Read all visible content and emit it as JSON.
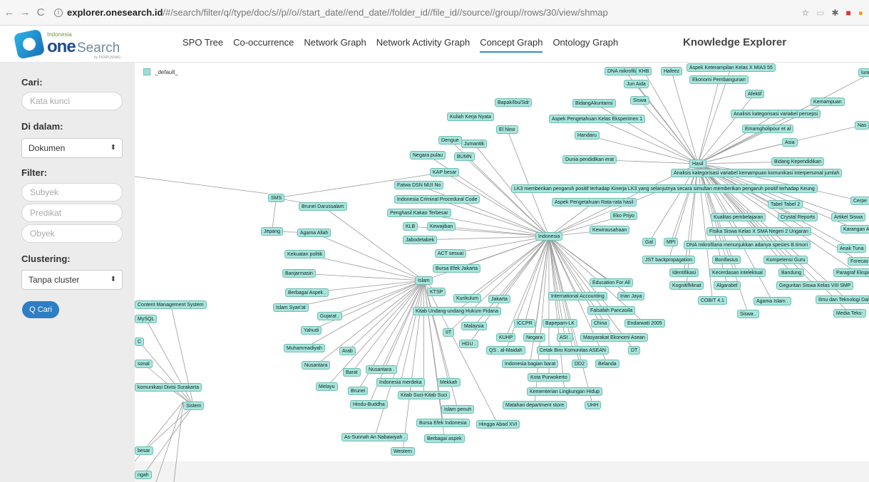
{
  "browser": {
    "back": "←",
    "forward": "→",
    "reload": "C",
    "url_host": "explorer.onesearch.id",
    "url_path": "/#/search/filter/q//type/doc/s//p//o//start_date//end_date//folder_id//file_id//source//group//rows/30/view/shmap"
  },
  "logo": {
    "small": "Indonesia",
    "one": "one",
    "search": "Search",
    "perpus": "by PERPUSNAS"
  },
  "menu": [
    "SPO Tree",
    "Co-occurrence",
    "Network Graph",
    "Network Activity Graph",
    "Concept Graph",
    "Ontology Graph"
  ],
  "menu_active": "Concept Graph",
  "header_title": "Knowledge Explorer",
  "sidebar": {
    "cari_label": "Cari:",
    "cari_placeholder": "Kata kunci",
    "didalam_label": "Di dalam:",
    "didalam_value": "Dokumen",
    "filter_label": "Filter:",
    "subyek": "Subyek",
    "predikat": "Predikat",
    "obyek": "Obyek",
    "clustering_label": "Clustering:",
    "clustering_value": "Tanpa cluster",
    "search_button": "Q Cari"
  },
  "legend": "_default_",
  "colors": {
    "node_fill": "#a8e6dc",
    "node_border": "#6fbcb2",
    "accent": "#2d7ec4"
  },
  "graph": {
    "nodes": [
      {
        "id": "indonesia",
        "label": "Indonesia"
      },
      {
        "id": "islam",
        "label": "Islam"
      },
      {
        "id": "hasil",
        "label": "Hasil"
      },
      {
        "id": "sms",
        "label": "SMS"
      },
      {
        "id": "jepang",
        "label": "Jepang"
      },
      {
        "id": "sistem",
        "label": "Sistem"
      },
      {
        "id": "dna1",
        "label": "DNA mikrofilaria"
      },
      {
        "id": "khb",
        "label": "KHB"
      },
      {
        "id": "hafeez",
        "label": "Hafeez"
      },
      {
        "id": "aspekket",
        "label": "Aspek Keterampilan Kelas X MIA3 55"
      },
      {
        "id": "junaida",
        "label": "Jun Aida"
      },
      {
        "id": "ekonomi",
        "label": "Ekonomi Pembangunan"
      },
      {
        "id": "siswa",
        "label": "Siswa"
      },
      {
        "id": "bidangak",
        "label": "BidangAkuntansi"
      },
      {
        "id": "afektif",
        "label": "Afektif"
      },
      {
        "id": "kemampuan",
        "label": "Kemampuan"
      },
      {
        "id": "bapak",
        "label": "Bapak/Ibu/Sdr"
      },
      {
        "id": "aspekpeng",
        "label": "Aspek Pengetahuan Kelas Eksperimen 1"
      },
      {
        "id": "analisis1",
        "label": "Analisis kategorisasi variabel persepsi"
      },
      {
        "id": "kuliah",
        "label": "Kuliah Kerja Nyata"
      },
      {
        "id": "elnino",
        "label": "El Nino"
      },
      {
        "id": "handaru",
        "label": "Handaru"
      },
      {
        "id": "emamgh",
        "label": "Emamgholipour et al"
      },
      {
        "id": "dengue",
        "label": "Dengue"
      },
      {
        "id": "jumantik",
        "label": "Jumantik"
      },
      {
        "id": "asia",
        "label": "Asia"
      },
      {
        "id": "negarapulau",
        "label": "Negara pulau"
      },
      {
        "id": "bumn",
        "label": "BUMN"
      },
      {
        "id": "duniapend",
        "label": "Dunia pendidikan erat"
      },
      {
        "id": "bidangkep",
        "label": "Bidang Kependidikan"
      },
      {
        "id": "kapbesar",
        "label": "KAP besar"
      },
      {
        "id": "analisis2",
        "label": "Analisis kategorisasi variabel kemampuan komunikasi interpersonal jumlah"
      },
      {
        "id": "fatwa",
        "label": "Fatwa DSN MUI No"
      },
      {
        "id": "icpc",
        "label": "Indonesia Criminal Procedural Code"
      },
      {
        "id": "lk3",
        "label": "LK3 memberikan pengaruh positif terhadap Kinerja LK3 yang selanjutnya secara simultan memberikan pengaruh positif terhadap Keung"
      },
      {
        "id": "aspekrata",
        "label": "Aspek Pengetahuan Rata-rata hasil"
      },
      {
        "id": "tabel2",
        "label": "Tabel Tabel 2"
      },
      {
        "id": "cerpe",
        "label": "Cerpe"
      },
      {
        "id": "brunei1",
        "label": "Brunei Darussalam"
      },
      {
        "id": "penghasil",
        "label": "Penghasil Kakao Terbesar"
      },
      {
        "id": "ekopriyo",
        "label": "Eko Priyo"
      },
      {
        "id": "kualitas",
        "label": "Kualitas pembelajaran"
      },
      {
        "id": "crystal",
        "label": "Crystal Reports"
      },
      {
        "id": "artikel",
        "label": "Artikel Siswa"
      },
      {
        "id": "klb",
        "label": "KLB"
      },
      {
        "id": "kewajiban",
        "label": "Kewajiban"
      },
      {
        "id": "kewirausahaan",
        "label": "Kewirausahaan"
      },
      {
        "id": "fisika",
        "label": "Fisika Siswa Kelas X SMA Negeri 2 Ungaran"
      },
      {
        "id": "karangan",
        "label": "Karangan A"
      },
      {
        "id": "agamaallah",
        "label": "Agama Allah"
      },
      {
        "id": "jabodetabek",
        "label": "Jabodetabek"
      },
      {
        "id": "gal",
        "label": "Gal"
      },
      {
        "id": "mpi",
        "label": "MPI"
      },
      {
        "id": "dna2",
        "label": "DNA mikrofilaria menunjukkan adanya spesies B.timori"
      },
      {
        "id": "anaktuna",
        "label": "Anak Tuna"
      },
      {
        "id": "kekuatan",
        "label": "Kekuatan politik"
      },
      {
        "id": "actsesuai",
        "label": "ACT sesuai"
      },
      {
        "id": "jst",
        "label": "JST backpropagation"
      },
      {
        "id": "bonifasius",
        "label": "Bonifasius"
      },
      {
        "id": "kompetensi",
        "label": "Kompetensi Guru"
      },
      {
        "id": "forecast",
        "label": "Forecas"
      },
      {
        "id": "bursa1",
        "label": "Bursa Efek Jakarta"
      },
      {
        "id": "banjarmasin",
        "label": "Banjarmasin"
      },
      {
        "id": "identifikasi",
        "label": "Identifikasi"
      },
      {
        "id": "kecerdasan",
        "label": "Kecerdasan intelektual"
      },
      {
        "id": "bandung",
        "label": "Bandung"
      },
      {
        "id": "paragraf",
        "label": "Paragraf Eksposisi"
      },
      {
        "id": "eduall",
        "label": "Education For All"
      },
      {
        "id": "kognitif",
        "label": "KognitifMinat"
      },
      {
        "id": "algarabel",
        "label": "Algarabel"
      },
      {
        "id": "geguritan",
        "label": "Geguritan Siswa Kelas VIII SMP"
      },
      {
        "id": "berbagai1",
        "label": "Berbagai Aspek ."
      },
      {
        "id": "ktsp",
        "label": "KTSP"
      },
      {
        "id": "intacc",
        "label": "International Accounting"
      },
      {
        "id": "irianjaya",
        "label": "Irian Jaya"
      },
      {
        "id": "cobit",
        "label": "COBIT 4.1"
      },
      {
        "id": "agamaislam",
        "label": "Agama Islam ."
      },
      {
        "id": "ilmu",
        "label": "Ilmu dan Teknologi Dalam"
      },
      {
        "id": "cms",
        "label": "Content Management System"
      },
      {
        "id": "islamsyariat",
        "label": "Islam Syari'at"
      },
      {
        "id": "kurikulum",
        "label": "Kurikulum"
      },
      {
        "id": "jakarta",
        "label": "Jakarta"
      },
      {
        "id": "falsafah",
        "label": "Falsafah Pancasila"
      },
      {
        "id": "mediateks",
        "label": "Media Teks-"
      },
      {
        "id": "mysql",
        "label": "MySQL"
      },
      {
        "id": "kitabuu",
        "label": "Kitab Undang-undang Hukum Pidana"
      },
      {
        "id": "siswadot",
        "label": "Siswa ."
      },
      {
        "id": "gujarat",
        "label": "Gujarat ."
      },
      {
        "id": "iccpr",
        "label": "ICCPR"
      },
      {
        "id": "bapepam",
        "label": "Bapepam-LK"
      },
      {
        "id": "china",
        "label": "China"
      },
      {
        "id": "endarwati",
        "label": "Endarwati 2005"
      },
      {
        "id": "malaysia",
        "label": "Malaysia"
      },
      {
        "id": "yahudi",
        "label": "Yahudi"
      },
      {
        "id": "iit",
        "label": "IIT"
      },
      {
        "id": "kuhp",
        "label": "KUHP"
      },
      {
        "id": "negara",
        "label": "Negara"
      },
      {
        "id": "asi",
        "label": "ASI ."
      },
      {
        "id": "masyarakat",
        "label": "Masyarakat Ekonomi Asean"
      },
      {
        "id": "muhammadiyah",
        "label": "Muhammadiyah"
      },
      {
        "id": "hgu",
        "label": "HGU ."
      },
      {
        "id": "arab",
        "label": "Arab"
      },
      {
        "id": "qs",
        "label": "QS . al-Maidah"
      },
      {
        "id": "cetakbiru",
        "label": "Cetak Biru Komunitas ASEAN"
      },
      {
        "id": "dt",
        "label": "DT"
      },
      {
        "id": "nusantara1",
        "label": "Nusantara"
      },
      {
        "id": "sonal",
        "label": "sonal"
      },
      {
        "id": "indobarat",
        "label": "Indonesia bagian barat"
      },
      {
        "id": "dd2",
        "label": "DD2"
      },
      {
        "id": "belanda",
        "label": "Belanda"
      },
      {
        "id": "barat",
        "label": "Barat"
      },
      {
        "id": "nusantara2",
        "label": "Nusantara ."
      },
      {
        "id": "melayu",
        "label": "Melayu"
      },
      {
        "id": "indomerdeka",
        "label": "Indonesia merdeka"
      },
      {
        "id": "mekkah",
        "label": "Mekkah"
      },
      {
        "id": "kotapur",
        "label": "Kota Purwokerto"
      },
      {
        "id": "komunikasi",
        "label": "komunikasi Divisi Surakarta"
      },
      {
        "id": "brunei2",
        "label": "Brunei"
      },
      {
        "id": "kitabsuci",
        "label": "Kitab Suci-Kitab Suci"
      },
      {
        "id": "kementerian",
        "label": "Kementerian Lingkungan Hidup"
      },
      {
        "id": "hindu",
        "label": "Hindu-Buddha"
      },
      {
        "id": "islampenuh",
        "label": "Islam penuh"
      },
      {
        "id": "matahari",
        "label": "Matahari department store"
      },
      {
        "id": "uhh",
        "label": "UHH"
      },
      {
        "id": "bursa2",
        "label": "Bursa Efek Indonesia"
      },
      {
        "id": "hingga",
        "label": "Hingga Abad XVI"
      },
      {
        "id": "assunnah",
        "label": "As-Sunnah An Nabawiyah ."
      },
      {
        "id": "berbagai2",
        "label": "Berbagai aspek"
      },
      {
        "id": "western",
        "label": "Western"
      },
      {
        "id": "besar",
        "label": "besar"
      },
      {
        "id": "ngah",
        "label": "ngah"
      },
      {
        "id": "luran",
        "label": "luran Jam"
      },
      {
        "id": "nas",
        "label": "Nas"
      },
      {
        "id": "cnode",
        "label": "C"
      }
    ],
    "edges": [
      [
        "indonesia",
        "kapbesar"
      ],
      [
        "indonesia",
        "fatwa"
      ],
      [
        "indonesia",
        "icpc"
      ],
      [
        "indonesia",
        "penghasil"
      ],
      [
        "indonesia",
        "klb"
      ],
      [
        "indonesia",
        "kewajiban"
      ],
      [
        "indonesia",
        "jabodetabek"
      ],
      [
        "indonesia",
        "actsesuai"
      ],
      [
        "indonesia",
        "bursa1"
      ],
      [
        "indonesia",
        "islam"
      ],
      [
        "indonesia",
        "kurikulum"
      ],
      [
        "indonesia",
        "jakarta"
      ],
      [
        "indonesia",
        "kitabuu"
      ],
      [
        "indonesia",
        "iccpr"
      ],
      [
        "indonesia",
        "bapepam"
      ],
      [
        "indonesia",
        "china"
      ],
      [
        "indonesia",
        "endarwati"
      ],
      [
        "indonesia",
        "malaysia"
      ],
      [
        "indonesia",
        "kuhp"
      ],
      [
        "indonesia",
        "negara"
      ],
      [
        "indonesia",
        "asi"
      ],
      [
        "indonesia",
        "masyarakat"
      ],
      [
        "indonesia",
        "qs"
      ],
      [
        "indonesia",
        "cetakbiru"
      ],
      [
        "indonesia",
        "dt"
      ],
      [
        "indonesia",
        "indobarat"
      ],
      [
        "indonesia",
        "dd2"
      ],
      [
        "indonesia",
        "belanda"
      ],
      [
        "indonesia",
        "intacc"
      ],
      [
        "indonesia",
        "irianjaya"
      ],
      [
        "indonesia",
        "falsafah"
      ],
      [
        "indonesia",
        "eduall"
      ],
      [
        "indonesia",
        "hasil"
      ],
      [
        "indonesia",
        "lk3"
      ],
      [
        "indonesia",
        "aspekrata"
      ],
      [
        "indonesia",
        "ekopriyo"
      ],
      [
        "indonesia",
        "kewirausahaan"
      ],
      [
        "indonesia",
        "jumantik"
      ],
      [
        "indonesia",
        "elnino"
      ],
      [
        "indonesia",
        "bumn"
      ],
      [
        "indonesia",
        "negarapulau"
      ],
      [
        "indonesia",
        "dengue"
      ],
      [
        "indonesia",
        "hgu"
      ],
      [
        "indonesia",
        "iit"
      ],
      [
        "indonesia",
        "kotapur"
      ],
      [
        "indonesia",
        "kementerian"
      ],
      [
        "indonesia",
        "matahari"
      ],
      [
        "indonesia",
        "uhh"
      ],
      [
        "islam",
        "agamaallah"
      ],
      [
        "islam",
        "kekuatan"
      ],
      [
        "islam",
        "banjarmasin"
      ],
      [
        "islam",
        "berbagai1"
      ],
      [
        "islam",
        "ktsp"
      ],
      [
        "islam",
        "islamsyariat"
      ],
      [
        "islam",
        "gujarat"
      ],
      [
        "islam",
        "yahudi"
      ],
      [
        "islam",
        "muhammadiyah"
      ],
      [
        "islam",
        "arab"
      ],
      [
        "islam",
        "nusantara1"
      ],
      [
        "islam",
        "barat"
      ],
      [
        "islam",
        "nusantara2"
      ],
      [
        "islam",
        "melayu"
      ],
      [
        "islam",
        "brunei2"
      ],
      [
        "islam",
        "indomerdeka"
      ],
      [
        "islam",
        "mekkah"
      ],
      [
        "islam",
        "kitabsuci"
      ],
      [
        "islam",
        "hindu"
      ],
      [
        "islam",
        "islampenuh"
      ],
      [
        "islam",
        "bursa2"
      ],
      [
        "islam",
        "hingga"
      ],
      [
        "islam",
        "assunnah"
      ],
      [
        "islam",
        "berbagai2"
      ],
      [
        "islam",
        "western"
      ],
      [
        "islam",
        "brunei1"
      ],
      [
        "hasil",
        "dna1"
      ],
      [
        "hasil",
        "khb"
      ],
      [
        "hasil",
        "hafeez"
      ],
      [
        "hasil",
        "aspekket"
      ],
      [
        "hasil",
        "junaida"
      ],
      [
        "hasil",
        "ekonomi"
      ],
      [
        "hasil",
        "siswa"
      ],
      [
        "hasil",
        "bidangak"
      ],
      [
        "hasil",
        "afektif"
      ],
      [
        "hasil",
        "kemampuan"
      ],
      [
        "hasil",
        "aspekpeng"
      ],
      [
        "hasil",
        "analisis1"
      ],
      [
        "hasil",
        "handaru"
      ],
      [
        "hasil",
        "emamgh"
      ],
      [
        "hasil",
        "asia"
      ],
      [
        "hasil",
        "duniapend"
      ],
      [
        "hasil",
        "bidangkep"
      ],
      [
        "hasil",
        "analisis2"
      ],
      [
        "hasil",
        "tabel2"
      ],
      [
        "hasil",
        "kualitas"
      ],
      [
        "hasil",
        "crystal"
      ],
      [
        "hasil",
        "fisika"
      ],
      [
        "hasil",
        "gal"
      ],
      [
        "hasil",
        "mpi"
      ],
      [
        "hasil",
        "dna2"
      ],
      [
        "hasil",
        "jst"
      ],
      [
        "hasil",
        "bonifasius"
      ],
      [
        "hasil",
        "kompetensi"
      ],
      [
        "hasil",
        "identifikasi"
      ],
      [
        "hasil",
        "kecerdasan"
      ],
      [
        "hasil",
        "bandung"
      ],
      [
        "hasil",
        "kognitif"
      ],
      [
        "hasil",
        "algarabel"
      ],
      [
        "hasil",
        "cobit"
      ],
      [
        "hasil",
        "agamaislam"
      ],
      [
        "hasil",
        "siswadot"
      ],
      [
        "hasil",
        "luran"
      ],
      [
        "hasil",
        "nas"
      ],
      [
        "hasil",
        "cerpe"
      ],
      [
        "hasil",
        "artikel"
      ],
      [
        "hasil",
        "karangan"
      ],
      [
        "hasil",
        "anaktuna"
      ],
      [
        "hasil",
        "forecast"
      ],
      [
        "hasil",
        "paragraf"
      ],
      [
        "hasil",
        "geguritan"
      ],
      [
        "hasil",
        "ilmu"
      ],
      [
        "hasil",
        "mediateks"
      ],
      [
        "sms",
        "jepang"
      ],
      [
        "sistem",
        "cms"
      ],
      [
        "sistem",
        "mysql"
      ],
      [
        "sistem",
        "komunikasi"
      ],
      [
        "sistem",
        "sonal"
      ],
      [
        "sistem",
        "besar"
      ],
      [
        "sistem",
        "ngah"
      ],
      [
        "sistem",
        "cnode"
      ],
      [
        "jepang",
        "agamaallah"
      ],
      [
        "sms",
        "kapbesar"
      ],
      [
        "sms",
        "brunei1"
      ]
    ]
  }
}
